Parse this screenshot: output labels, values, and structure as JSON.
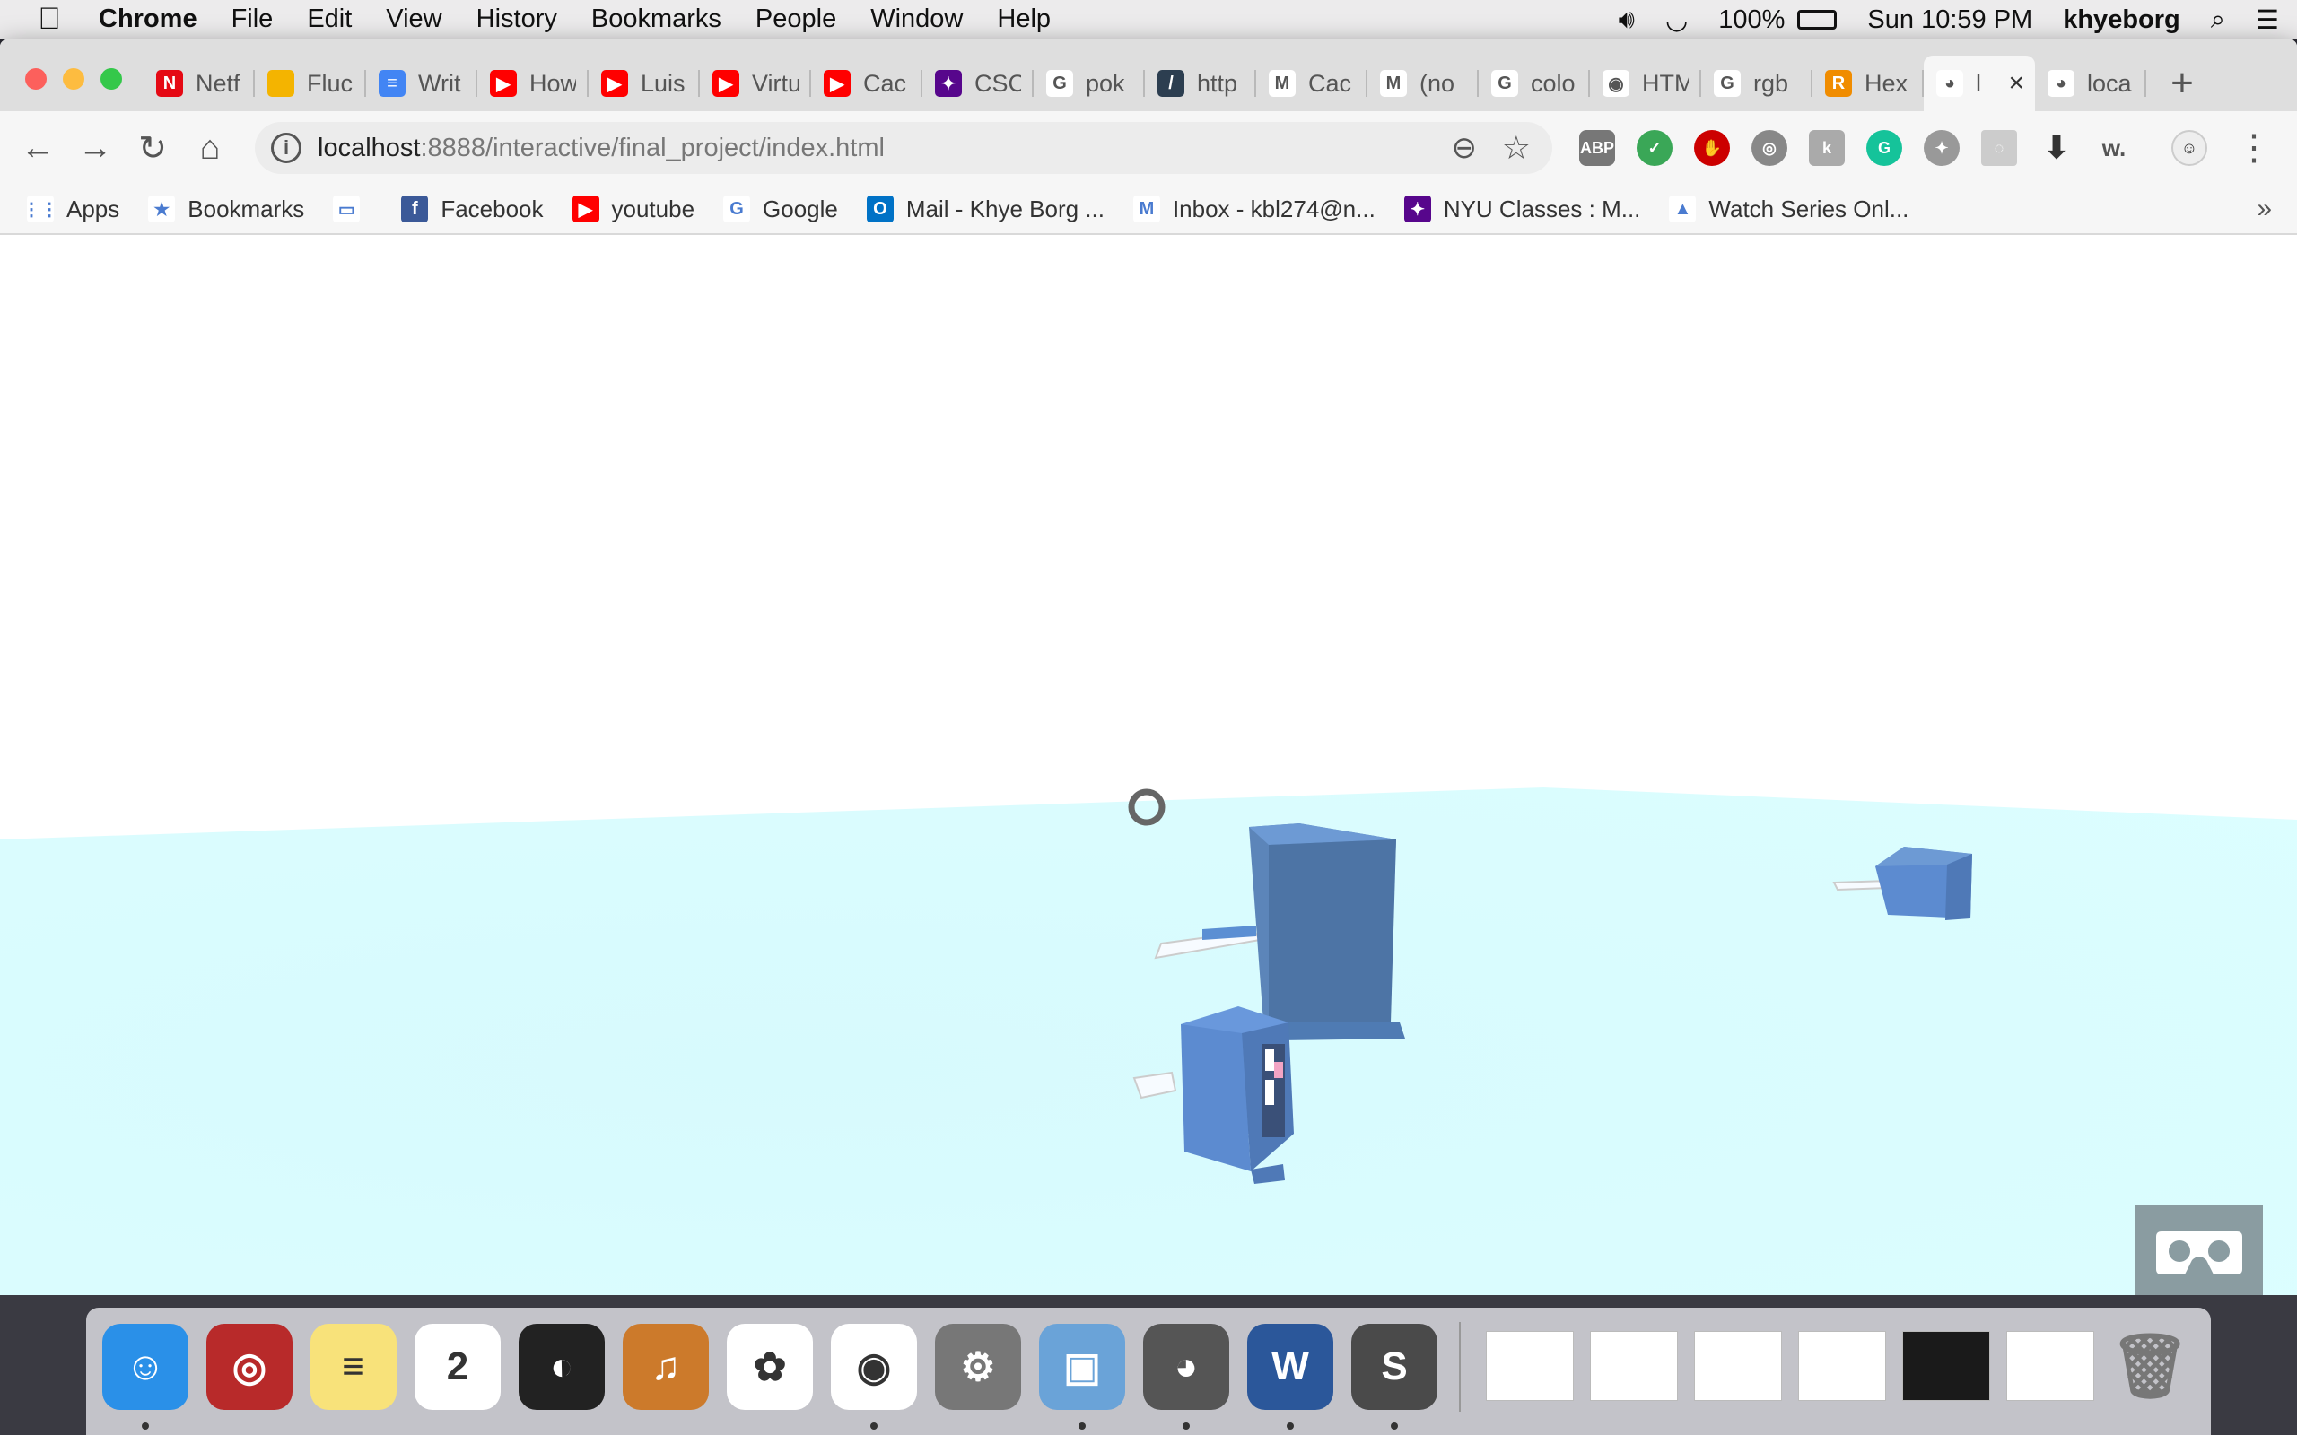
{
  "menubar": {
    "app": "Chrome",
    "items": [
      "File",
      "Edit",
      "View",
      "History",
      "Bookmarks",
      "People",
      "Window",
      "Help"
    ],
    "battery": "100%",
    "clock": "Sun 10:59 PM",
    "user": "khyeborg"
  },
  "tabs": [
    {
      "title": "Netf",
      "icon": "netflix-icon",
      "color": "#e50914",
      "glyph": "N"
    },
    {
      "title": "Fluc",
      "icon": "slides-icon",
      "color": "#f4b400",
      "glyph": ""
    },
    {
      "title": "Writ",
      "icon": "docs-icon",
      "color": "#4285f4",
      "glyph": "≡"
    },
    {
      "title": "How",
      "icon": "youtube-icon",
      "color": "#ff0000",
      "glyph": "▶"
    },
    {
      "title": "Luis",
      "icon": "youtube-icon",
      "color": "#ff0000",
      "glyph": "▶"
    },
    {
      "title": "Virtu",
      "icon": "youtube-icon",
      "color": "#ff0000",
      "glyph": "▶"
    },
    {
      "title": "Cac",
      "icon": "youtube-icon",
      "color": "#ff0000",
      "glyph": "▶"
    },
    {
      "title": "CSC",
      "icon": "nyu-icon",
      "color": "#57068c",
      "glyph": "✦"
    },
    {
      "title": "pok",
      "icon": "google-icon",
      "color": "#ffffff",
      "glyph": "G"
    },
    {
      "title": "http",
      "icon": "pen-icon",
      "color": "#2c3e50",
      "glyph": "/"
    },
    {
      "title": "Cac",
      "icon": "gmail-icon",
      "color": "#ffffff",
      "glyph": "M"
    },
    {
      "title": "(no",
      "icon": "gmail-icon",
      "color": "#ffffff",
      "glyph": "M"
    },
    {
      "title": "colo",
      "icon": "google-icon",
      "color": "#ffffff",
      "glyph": "G"
    },
    {
      "title": "HTM",
      "icon": "color-wheel-icon",
      "color": "#ffffff",
      "glyph": "◉"
    },
    {
      "title": "rgb",
      "icon": "google-icon",
      "color": "#ffffff",
      "glyph": "G"
    },
    {
      "title": "Hex",
      "icon": "r-icon",
      "color": "#f08c00",
      "glyph": "R"
    },
    {
      "title": "l",
      "icon": "mamp-icon",
      "color": "#ffffff",
      "glyph": "◕",
      "active": true
    },
    {
      "title": "loca",
      "icon": "mamp-icon",
      "color": "#ffffff",
      "glyph": "◕"
    }
  ],
  "address": {
    "host": "localhost",
    "path": ":8888/interactive/final_project/index.html"
  },
  "bookmarks": [
    {
      "label": "Apps",
      "icon": "apps-icon",
      "color": "#ffffff",
      "glyph": "⋮⋮"
    },
    {
      "label": "Bookmarks",
      "icon": "star-icon",
      "color": "#ffffff",
      "glyph": "★"
    },
    {
      "label": "",
      "icon": "folder-icon",
      "color": "#ffffff",
      "glyph": "▭"
    },
    {
      "label": "Facebook",
      "icon": "facebook-icon",
      "color": "#3b5998",
      "glyph": "f"
    },
    {
      "label": "youtube",
      "icon": "youtube-icon",
      "color": "#ff0000",
      "glyph": "▶"
    },
    {
      "label": "Google",
      "icon": "google-icon",
      "color": "#ffffff",
      "glyph": "G"
    },
    {
      "label": "Mail - Khye Borg ...",
      "icon": "outlook-icon",
      "color": "#0072c6",
      "glyph": "O"
    },
    {
      "label": "Inbox - kbl274@n...",
      "icon": "gmail-icon",
      "color": "#ffffff",
      "glyph": "M"
    },
    {
      "label": "NYU Classes : M...",
      "icon": "nyu-icon",
      "color": "#57068c",
      "glyph": "✦"
    },
    {
      "label": "Watch Series Onl...",
      "icon": "watch-series-icon",
      "color": "#ffffff",
      "glyph": "▲"
    }
  ],
  "colors": {
    "sky": "#ffffff",
    "ground": "#dcfdff",
    "cube": "#5b8fd3",
    "vr_button": "#8a9ca1"
  },
  "dock": [
    {
      "name": "finder-icon",
      "color": "#2a90e8",
      "glyph": "☺",
      "running": true
    },
    {
      "name": "photo-booth-icon",
      "color": "#b82a2a",
      "glyph": "◎"
    },
    {
      "name": "notes-icon",
      "color": "#f8e27a",
      "glyph": "≡"
    },
    {
      "name": "calendar-icon",
      "color": "#ffffff",
      "glyph": "2"
    },
    {
      "name": "logic-icon",
      "color": "#222222",
      "glyph": "◐"
    },
    {
      "name": "garageband-icon",
      "color": "#cc7a2b",
      "glyph": "♫"
    },
    {
      "name": "photos-icon",
      "color": "#ffffff",
      "glyph": "✿"
    },
    {
      "name": "chrome-icon",
      "color": "#ffffff",
      "glyph": "◉",
      "running": true
    },
    {
      "name": "system-preferences-icon",
      "color": "#777777",
      "glyph": "⚙"
    },
    {
      "name": "preview-icon",
      "color": "#6aa3d8",
      "glyph": "▣",
      "running": true
    },
    {
      "name": "mamp-icon",
      "color": "#555555",
      "glyph": "◕",
      "running": true
    },
    {
      "name": "word-icon",
      "color": "#2b579a",
      "glyph": "W",
      "running": true
    },
    {
      "name": "sublime-text-icon",
      "color": "#4a4a4a",
      "glyph": "S",
      "running": true
    }
  ]
}
